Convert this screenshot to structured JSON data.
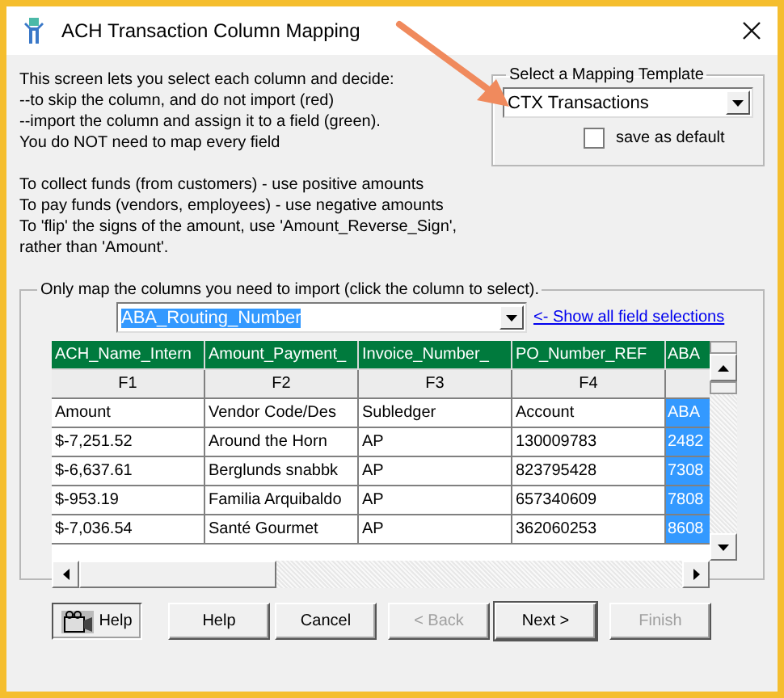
{
  "window": {
    "title": "ACH Transaction Column Mapping"
  },
  "instructions": [
    "This screen lets you select each column and decide:",
    "--to skip the column, and do not import (red)",
    "--import the column and assign it to a field (green).",
    "You do NOT need to map every field"
  ],
  "amount_notes": [
    "To collect funds (from customers) - use positive amounts",
    "To pay funds (vendors, employees) - use negative amounts",
    "To 'flip' the signs of the amount, use 'Amount_Reverse_Sign',",
    "rather than 'Amount'."
  ],
  "template": {
    "label": "Select a Mapping Template",
    "value": "CTX Transactions",
    "save_as_default": {
      "label": "save as default",
      "checked": false
    }
  },
  "mapping": {
    "label": "Only map the columns you need to import (click the column to select).",
    "field_value": "ABA_Routing_Number",
    "link": "<- Show all field selections"
  },
  "table": {
    "columns": [
      {
        "field": "ACH_Name_Intern",
        "header": "F1",
        "selected": false
      },
      {
        "field": "Amount_Payment_",
        "header": "F2",
        "selected": false
      },
      {
        "field": "Invoice_Number_",
        "header": "F3",
        "selected": false
      },
      {
        "field": "PO_Number_REF",
        "header": "F4",
        "selected": false
      },
      {
        "field": "ABA",
        "selected": true
      }
    ],
    "rows": [
      [
        "Amount",
        "Vendor Code/Des",
        "Subledger",
        "Account",
        "ABA"
      ],
      [
        "$-7,251.52",
        "Around the Horn",
        "AP",
        "130009783",
        "2482"
      ],
      [
        "$-6,637.61",
        "Berglunds snabbk",
        "AP",
        "823795428",
        "7308"
      ],
      [
        "$-953.19",
        "Familia Arquibaldo",
        "AP",
        "657340609",
        "7808"
      ],
      [
        "$-7,036.54",
        "Santé Gourmet",
        "AP",
        "362060253",
        "8608"
      ]
    ]
  },
  "buttons": [
    {
      "label": "Help",
      "kind": "icon",
      "disabled": false
    },
    {
      "label": "Help",
      "kind": "plain",
      "disabled": false
    },
    {
      "label": "Cancel",
      "kind": "plain",
      "disabled": false
    },
    {
      "label": "< Back",
      "kind": "plain",
      "disabled": true
    },
    {
      "label": "Next >",
      "kind": "default",
      "disabled": false
    },
    {
      "label": "Finish",
      "kind": "plain",
      "disabled": true
    }
  ]
}
